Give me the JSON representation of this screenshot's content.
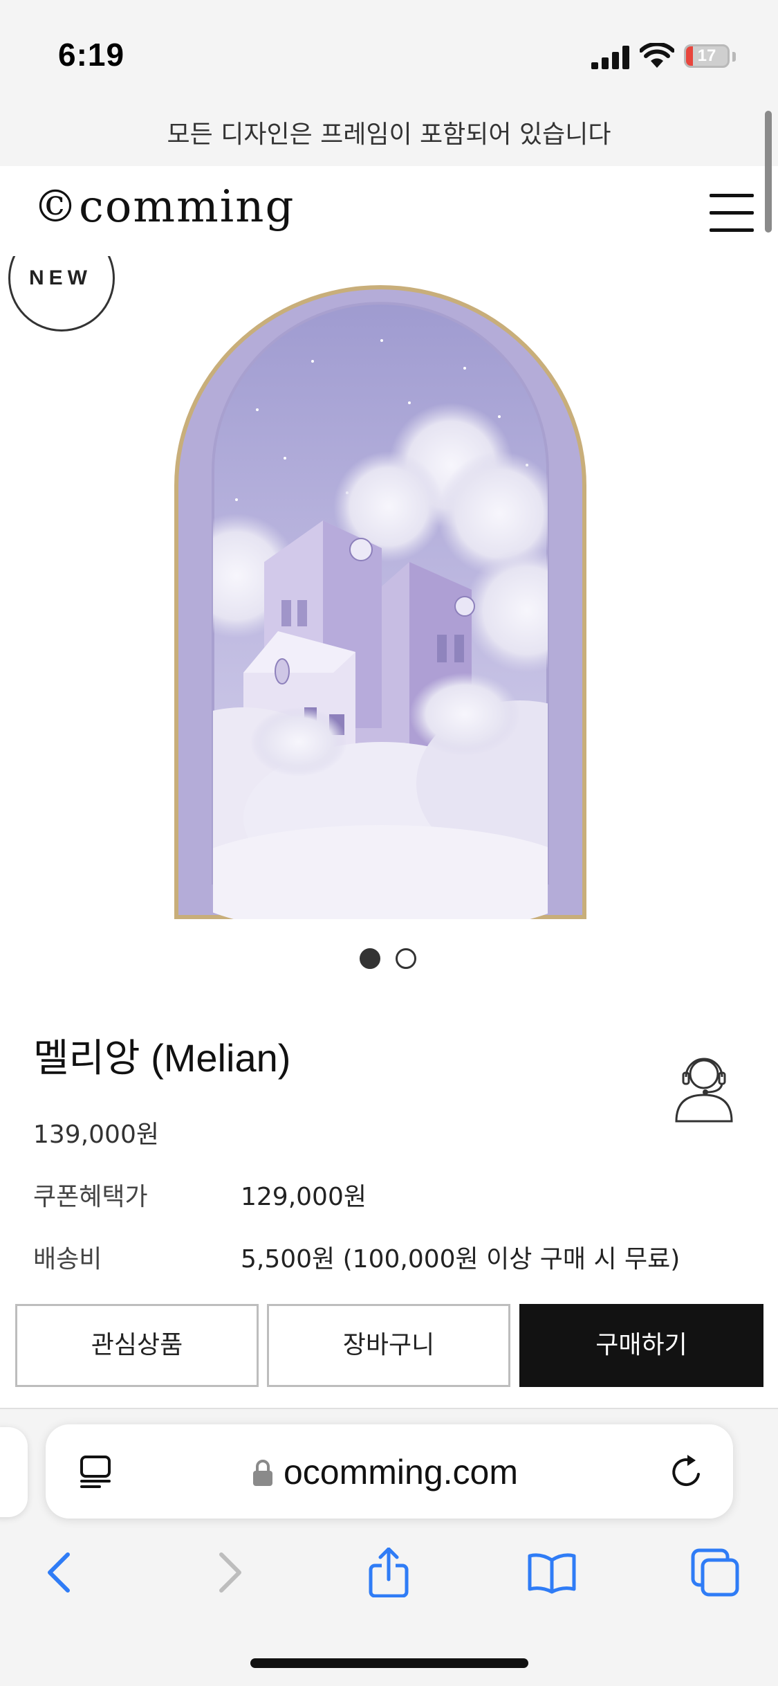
{
  "status_bar": {
    "time": "6:19",
    "battery_level": "17",
    "battery_fraction": 0.17,
    "icons": [
      "cellular-signal-icon",
      "wifi-icon",
      "battery-icon"
    ]
  },
  "notice_banner": "모든 디자인은 프레임이 포함되어 있습니다",
  "header": {
    "logo": "©comming",
    "menu_icon": "hamburger-menu-icon"
  },
  "badge": "NEW",
  "gallery": {
    "current_slide": 1,
    "total_slides": 2
  },
  "product": {
    "name": "멜리앙 (Melian)",
    "price": "139,000원",
    "coupon_label": "쿠폰혜택가",
    "coupon_price": "129,000원",
    "shipping_label": "배송비",
    "shipping_value": "5,500원 (100,000원 이상 구매 시 무료)",
    "support_icon": "customer-support-icon"
  },
  "actions": {
    "wishlist": "관심상품",
    "cart": "장바구니",
    "buy": "구매하기"
  },
  "browser": {
    "url": "ocomming.com",
    "icons": [
      "reader-mode-icon",
      "lock-icon",
      "reload-icon",
      "back-icon",
      "forward-icon",
      "share-icon",
      "bookmarks-icon",
      "tabs-icon"
    ]
  },
  "colors": {
    "accent_black": "#121212",
    "frame_gold": "#c8ae7a",
    "artwork_lavender": "#b4acd8",
    "link_blue": "#2f7cf6"
  }
}
